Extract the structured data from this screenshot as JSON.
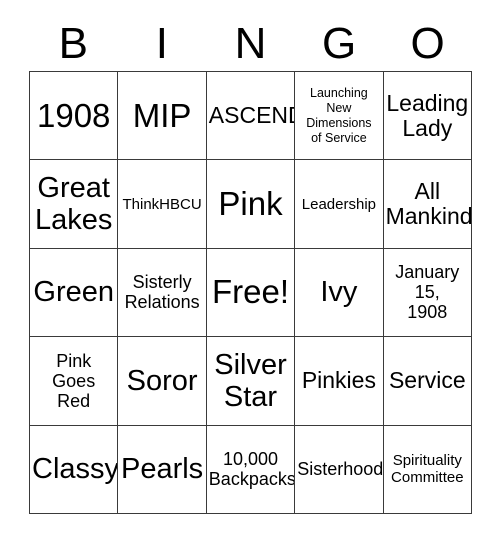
{
  "card": {
    "header": {
      "letters": [
        "B",
        "I",
        "N",
        "G",
        "O"
      ]
    },
    "grid": {
      "columns": 5,
      "rows": 5,
      "free_space": {
        "row": 3,
        "column": 3,
        "label": "Free!"
      },
      "cells": [
        {
          "text": "1908",
          "size": "xl"
        },
        {
          "text": "MIP",
          "size": "xl"
        },
        {
          "text": "ASCEND",
          "size": "md"
        },
        {
          "text": "Launching\nNew\nDimensions\nof Service",
          "size": "xxs"
        },
        {
          "text": "Leading\nLady",
          "size": "md"
        },
        {
          "text": "Great\nLakes",
          "size": "lg"
        },
        {
          "text": "ThinkHBCU",
          "size": "xs"
        },
        {
          "text": "Pink",
          "size": "xl"
        },
        {
          "text": "Leadership",
          "size": "xs"
        },
        {
          "text": "All\nMankind",
          "size": "md"
        },
        {
          "text": "Green",
          "size": "lg"
        },
        {
          "text": "Sisterly\nRelations",
          "size": "sm"
        },
        {
          "text": "Free!",
          "size": "xl"
        },
        {
          "text": "Ivy",
          "size": "lg"
        },
        {
          "text": "January\n15,\n1908",
          "size": "sm"
        },
        {
          "text": "Pink\nGoes\nRed",
          "size": "sm"
        },
        {
          "text": "Soror",
          "size": "lg"
        },
        {
          "text": "Silver\nStar",
          "size": "lg"
        },
        {
          "text": "Pinkies",
          "size": "md"
        },
        {
          "text": "Service",
          "size": "md"
        },
        {
          "text": "Classy",
          "size": "lg"
        },
        {
          "text": "Pearls",
          "size": "lg"
        },
        {
          "text": "10,000\nBackpacks",
          "size": "sm"
        },
        {
          "text": "Sisterhood",
          "size": "sm"
        },
        {
          "text": "Spirituality\nCommittee",
          "size": "xs"
        }
      ]
    }
  }
}
